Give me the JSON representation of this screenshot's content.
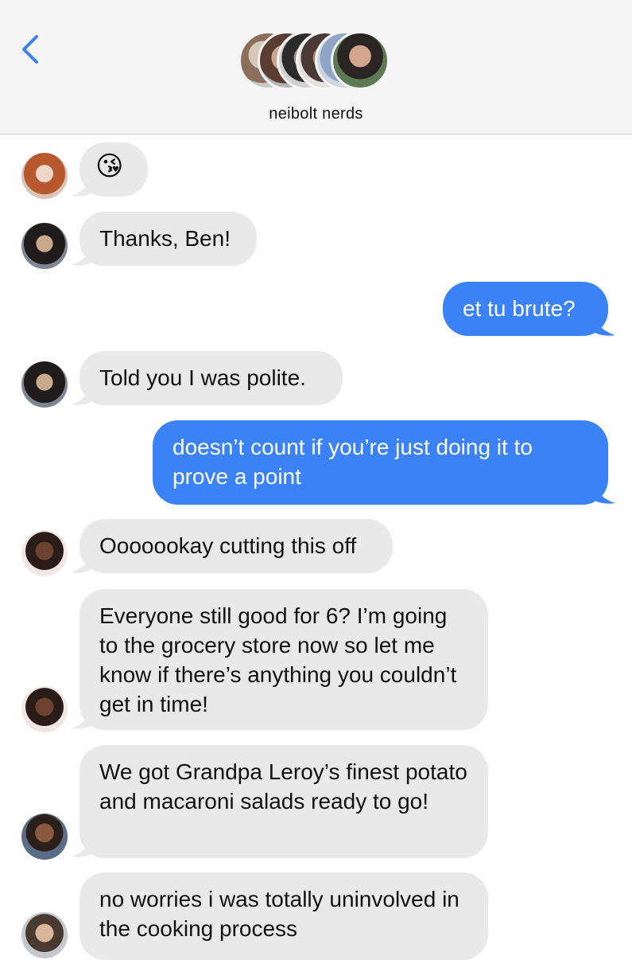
{
  "conversation": {
    "title": "neibolt nerds",
    "back_icon": "chevron-left-icon",
    "accent_color": "#3a82f6",
    "incoming_color": "#e9e9eb"
  },
  "messages": [
    {
      "sender": "redhead-woman",
      "direction": "in",
      "text": "😘"
    },
    {
      "sender": "dark-haired-man",
      "direction": "in",
      "text": "Thanks, Ben!"
    },
    {
      "sender": "me",
      "direction": "out",
      "text": "et tu brute?"
    },
    {
      "sender": "dark-haired-man",
      "direction": "in",
      "text": "Told you I was polite."
    },
    {
      "sender": "me",
      "direction": "out",
      "text": "doesn’t count if you’re just doing it to prove a point"
    },
    {
      "sender": "braided-woman",
      "direction": "in",
      "text": "Ooooookay cutting this off"
    },
    {
      "sender": "braided-woman",
      "direction": "in",
      "text": "Everyone still good for 6? I’m going to the grocery store now so let me know if there’s anything you couldn’t get in time!"
    },
    {
      "sender": "smiling-man",
      "direction": "in",
      "text": "We got Grandpa Leroy’s finest potato and macaroni salads ready to go!"
    },
    {
      "sender": "bearded-man",
      "direction": "in",
      "text": "no worries i was totally uninvolved in the cooking process"
    }
  ]
}
